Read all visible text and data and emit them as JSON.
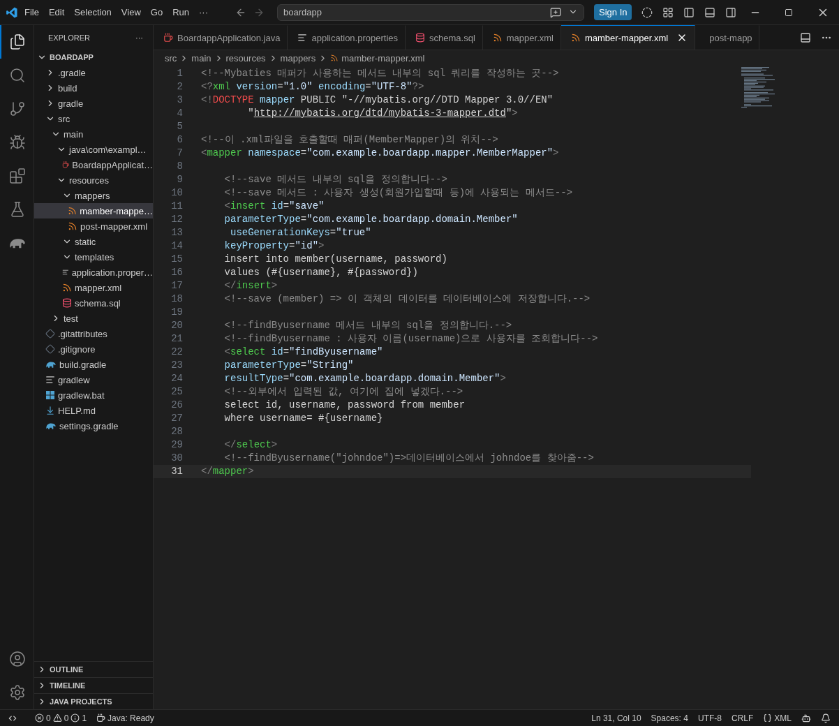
{
  "title_bar": {
    "menu": [
      "File",
      "Edit",
      "Selection",
      "View",
      "Go",
      "Run",
      "···"
    ],
    "search": "boardapp",
    "sign_in": "Sign In"
  },
  "activity_bar": [
    {
      "kind": "explorer",
      "selected": true
    },
    {
      "kind": "search",
      "selected": false
    },
    {
      "kind": "source-control",
      "selected": false
    },
    {
      "kind": "run-debug",
      "selected": false
    },
    {
      "kind": "extensions",
      "selected": false
    },
    {
      "kind": "testing",
      "selected": false
    },
    {
      "kind": "gradle",
      "selected": false
    }
  ],
  "sidebar": {
    "title": "EXPLORER",
    "more": "···",
    "root": {
      "label": "BOARDAPP",
      "expanded": true
    },
    "tree": [
      {
        "label": ".gradle",
        "kind": "folder",
        "expanded": false,
        "selected": false
      },
      {
        "label": "build",
        "kind": "folder",
        "expanded": false,
        "selected": false
      },
      {
        "label": "gradle",
        "kind": "folder",
        "expanded": false,
        "selected": false
      },
      {
        "label": "src",
        "kind": "folder",
        "expanded": true,
        "selected": false,
        "children": [
          {
            "label": "main",
            "kind": "folder",
            "expanded": true,
            "selected": false,
            "children": [
              {
                "label": "java\\com\\exampl…",
                "kind": "folder",
                "expanded": true,
                "selected": false,
                "children": [
                  {
                    "label": "BoardappApplicat…",
                    "kind": "java",
                    "selected": false
                  }
                ]
              },
              {
                "label": "resources",
                "kind": "folder",
                "expanded": true,
                "selected": false,
                "children": [
                  {
                    "label": "mappers",
                    "kind": "folder",
                    "expanded": true,
                    "selected": false,
                    "children": [
                      {
                        "label": "mamber-mappe…",
                        "kind": "xml",
                        "selected": true
                      },
                      {
                        "label": "post-mapper.xml",
                        "kind": "xml",
                        "selected": false
                      }
                    ]
                  },
                  {
                    "label": "static",
                    "kind": "folder",
                    "expanded": true,
                    "selected": false
                  },
                  {
                    "label": "templates",
                    "kind": "folder",
                    "expanded": true,
                    "selected": false
                  },
                  {
                    "label": "application.proper…",
                    "kind": "properties",
                    "selected": false
                  },
                  {
                    "label": "mapper.xml",
                    "kind": "xml",
                    "selected": false
                  },
                  {
                    "label": "schema.sql",
                    "kind": "sql",
                    "selected": false
                  }
                ]
              }
            ]
          },
          {
            "label": "test",
            "kind": "folder",
            "expanded": false,
            "selected": false
          }
        ]
      },
      {
        "label": ".gitattributes",
        "kind": "git",
        "selected": false
      },
      {
        "label": ".gitignore",
        "kind": "git",
        "selected": false
      },
      {
        "label": "build.gradle",
        "kind": "gradle",
        "selected": false
      },
      {
        "label": "gradlew",
        "kind": "properties",
        "selected": false
      },
      {
        "label": "gradlew.bat",
        "kind": "windows",
        "selected": false
      },
      {
        "label": "HELP.md",
        "kind": "download",
        "selected": false
      },
      {
        "label": "settings.gradle",
        "kind": "gradle",
        "selected": false
      }
    ],
    "panels": [
      {
        "label": "OUTLINE",
        "expanded": false
      },
      {
        "label": "TIMELINE",
        "expanded": false
      },
      {
        "label": "JAVA PROJECTS",
        "expanded": false
      }
    ]
  },
  "tabs": [
    {
      "label": "BoardappApplication.java",
      "kind": "java",
      "selected": false
    },
    {
      "label": "application.properties",
      "kind": "properties",
      "selected": false
    },
    {
      "label": "schema.sql",
      "kind": "sql",
      "selected": false
    },
    {
      "label": "mapper.xml",
      "kind": "xml",
      "selected": false
    },
    {
      "label": "mamber-mapper.xml",
      "kind": "xml",
      "selected": true
    },
    {
      "label": "post-mapp",
      "kind": "xml",
      "selected": false
    }
  ],
  "breadcrumb": [
    "src",
    "main",
    "resources",
    "mappers",
    "mamber-mapper.xml"
  ],
  "code": [
    {
      "number": "1",
      "selected": false,
      "tokens": [
        {
          "kind": "comment",
          "text": "<!--Mybaties 매퍼가 사용하는 메서드 내부의 sql 쿼리를 작성하는 곳-->"
        }
      ]
    },
    {
      "number": "2",
      "selected": false,
      "tokens": [
        {
          "kind": "punct",
          "text": "<?"
        },
        {
          "kind": "tag",
          "text": "xml"
        },
        {
          "kind": "attr",
          "text": " version"
        },
        {
          "kind": "text",
          "text": "="
        },
        {
          "kind": "string",
          "text": "\"1.0\""
        },
        {
          "kind": "attr",
          "text": " encoding"
        },
        {
          "kind": "text",
          "text": "="
        },
        {
          "kind": "string",
          "text": "\"UTF-8\""
        },
        {
          "kind": "punct",
          "text": "?>"
        }
      ]
    },
    {
      "number": "3",
      "selected": false,
      "tokens": [
        {
          "kind": "punct",
          "text": "<!"
        },
        {
          "kind": "doctype",
          "text": "DOCTYPE"
        },
        {
          "kind": "attr",
          "text": " mapper"
        },
        {
          "kind": "text",
          "text": " PUBLIC \"-//mybatis.org//DTD Mapper 3.0//EN\""
        }
      ]
    },
    {
      "number": "4",
      "selected": false,
      "tokens": [
        {
          "kind": "text",
          "text": "        \""
        },
        {
          "kind": "link",
          "text": "http://mybatis.org/dtd/mybatis-3-mapper.dtd"
        },
        {
          "kind": "text",
          "text": "\""
        },
        {
          "kind": "punct",
          "text": ">"
        }
      ]
    },
    {
      "number": "5",
      "selected": false
    },
    {
      "number": "6",
      "selected": false,
      "tokens": [
        {
          "kind": "comment",
          "text": "<!--이 .xml파일을 호출할때 매퍼(MemberMapper)의 위치-->"
        }
      ]
    },
    {
      "number": "7",
      "selected": false,
      "tokens": [
        {
          "kind": "punct",
          "text": "<"
        },
        {
          "kind": "tag",
          "text": "mapper"
        },
        {
          "kind": "attr",
          "text": " namespace"
        },
        {
          "kind": "text",
          "text": "="
        },
        {
          "kind": "string",
          "text": "\"com.example.boardapp.mapper.MemberMapper\""
        },
        {
          "kind": "punct",
          "text": ">"
        }
      ]
    },
    {
      "number": "8",
      "selected": false
    },
    {
      "number": "9",
      "selected": false,
      "tokens": [
        {
          "kind": "comment",
          "text": "    <!--save 메서드 내부의 sql을 정의합니다-->"
        }
      ]
    },
    {
      "number": "10",
      "selected": false,
      "tokens": [
        {
          "kind": "comment",
          "text": "    <!--save 메서드 : 사용자 생성(회원가입할때 등)에 사용되는 메서드-->"
        }
      ]
    },
    {
      "number": "11",
      "selected": false,
      "tokens": [
        {
          "kind": "punct",
          "text": "    <"
        },
        {
          "kind": "tag",
          "text": "insert"
        },
        {
          "kind": "attr",
          "text": " id"
        },
        {
          "kind": "text",
          "text": "="
        },
        {
          "kind": "string",
          "text": "\"save\""
        }
      ]
    },
    {
      "number": "12",
      "selected": false,
      "tokens": [
        {
          "kind": "attr",
          "text": "    parameterType"
        },
        {
          "kind": "text",
          "text": "="
        },
        {
          "kind": "string",
          "text": "\"com.example.boardapp.domain.Member\""
        }
      ]
    },
    {
      "number": "13",
      "selected": false,
      "tokens": [
        {
          "kind": "attr",
          "text": "     useGenerationKeys"
        },
        {
          "kind": "text",
          "text": "="
        },
        {
          "kind": "string",
          "text": "\"true\""
        }
      ]
    },
    {
      "number": "14",
      "selected": false,
      "tokens": [
        {
          "kind": "attr",
          "text": "    keyProperty"
        },
        {
          "kind": "text",
          "text": "="
        },
        {
          "kind": "string",
          "text": "\"id\""
        },
        {
          "kind": "punct",
          "text": ">"
        }
      ]
    },
    {
      "number": "15",
      "selected": false,
      "tokens": [
        {
          "kind": "text",
          "text": "    insert into member(username, password)"
        }
      ]
    },
    {
      "number": "16",
      "selected": false,
      "tokens": [
        {
          "kind": "text",
          "text": "    values (#{username}, #{password})"
        }
      ]
    },
    {
      "number": "17",
      "selected": false,
      "tokens": [
        {
          "kind": "punct",
          "text": "    </"
        },
        {
          "kind": "tag",
          "text": "insert"
        },
        {
          "kind": "punct",
          "text": ">"
        }
      ]
    },
    {
      "number": "18",
      "selected": false,
      "tokens": [
        {
          "kind": "comment",
          "text": "    <!--save (member) => 이 객체의 데이터를 데이터베이스에 저장합니다.-->"
        }
      ]
    },
    {
      "number": "19",
      "selected": false
    },
    {
      "number": "20",
      "selected": false,
      "tokens": [
        {
          "kind": "comment",
          "text": "    <!--findByusername 메서드 내부의 sql을 정의합니다.-->"
        }
      ]
    },
    {
      "number": "21",
      "selected": false,
      "tokens": [
        {
          "kind": "comment",
          "text": "    <!--findByusername : 사용자 이름(username)으로 사용자를 조회합니다-->"
        }
      ]
    },
    {
      "number": "22",
      "selected": false,
      "tokens": [
        {
          "kind": "punct",
          "text": "    <"
        },
        {
          "kind": "tag",
          "text": "select"
        },
        {
          "kind": "attr",
          "text": " id"
        },
        {
          "kind": "text",
          "text": "="
        },
        {
          "kind": "string",
          "text": "\"findByusername\""
        }
      ]
    },
    {
      "number": "23",
      "selected": false,
      "tokens": [
        {
          "kind": "attr",
          "text": "    parameterType"
        },
        {
          "kind": "text",
          "text": "="
        },
        {
          "kind": "string",
          "text": "\"String\""
        }
      ]
    },
    {
      "number": "24",
      "selected": false,
      "tokens": [
        {
          "kind": "attr",
          "text": "    resultType"
        },
        {
          "kind": "text",
          "text": "="
        },
        {
          "kind": "string",
          "text": "\"com.example.boardapp.domain.Member\""
        },
        {
          "kind": "punct",
          "text": ">"
        }
      ]
    },
    {
      "number": "25",
      "selected": false,
      "tokens": [
        {
          "kind": "comment",
          "text": "    <!--외부에서 입력된 값, 여기에 집에 넣겠다.-->"
        }
      ]
    },
    {
      "number": "26",
      "selected": false,
      "tokens": [
        {
          "kind": "text",
          "text": "    select id, username, password from member"
        }
      ]
    },
    {
      "number": "27",
      "selected": false,
      "tokens": [
        {
          "kind": "text",
          "text": "    where username= #{username}"
        }
      ]
    },
    {
      "number": "28",
      "selected": false
    },
    {
      "number": "29",
      "selected": false,
      "tokens": [
        {
          "kind": "punct",
          "text": "    </"
        },
        {
          "kind": "tag",
          "text": "select"
        },
        {
          "kind": "punct",
          "text": ">"
        }
      ]
    },
    {
      "number": "30",
      "selected": false,
      "tokens": [
        {
          "kind": "comment",
          "text": "    <!--findByusername(\"johndoe\")=>데이터베이스에서 johndoe를 찾아줌-->"
        }
      ]
    },
    {
      "number": "31",
      "selected": true,
      "tokens": [
        {
          "kind": "punct",
          "text": "</"
        },
        {
          "kind": "tag",
          "text": "mapper"
        },
        {
          "kind": "punct",
          "text": ">"
        }
      ]
    }
  ],
  "status_bar": {
    "errors": "0",
    "warnings": "0",
    "infos": "1",
    "java": "Java: Ready",
    "right": [
      "Ln 31, Col 10",
      "Spaces: 4",
      "UTF-8",
      "CRLF"
    ],
    "language": "XML"
  }
}
